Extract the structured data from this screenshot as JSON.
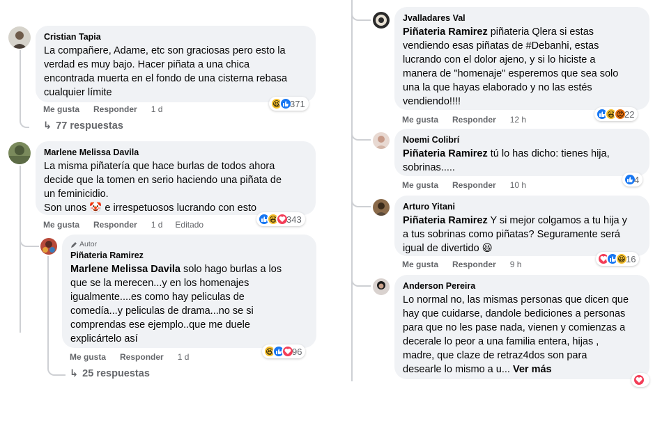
{
  "colors": {
    "bubble": "#f0f2f5",
    "meta": "#65676b",
    "like": "#1877f2",
    "haha": "#f7c12e",
    "love": "#f33e58",
    "angry": "#e9710f"
  },
  "left": {
    "c1": {
      "author": "Cristian Tapia",
      "lines": [
        "La compañere, Adame, etc son graciosas pero esto la",
        "verdad es muy bajo. Hacer piñata a una chica",
        "encontrada muerta en el fondo de una cisterna rebasa",
        "cualquier límite"
      ],
      "like": "Me gusta",
      "reply": "Responder",
      "time": "1 d",
      "reactions": [
        "haha-icon",
        "like-icon"
      ],
      "count": "371",
      "replies": "77 respuestas"
    },
    "c2": {
      "author": "Marlene Melissa Davila",
      "lines": [
        "La misma piñatería que hace burlas de todos ahora",
        "decide que la tomen en serio haciendo una piñata de",
        "un feminicidio."
      ],
      "line4_a": "Son unos",
      "line4_b": "e irrespetuosos lucrando con esto",
      "like": "Me gusta",
      "reply": "Responder",
      "time": "1 d",
      "edited": "Editado",
      "reactions": [
        "like-icon",
        "haha-icon",
        "love-icon"
      ],
      "count": "343"
    },
    "c3": {
      "badge": "Autor",
      "author": "Piñateria Ramirez",
      "mention": "Marlene Melissa Davila",
      "line1": "solo hago burlas a los",
      "lines": [
        "que se la merecen...y en los homenajes",
        "igualmente....es como hay peliculas de",
        "comedía...y peliculas de drama...no se si",
        "comprendas ese ejemplo..que me duele",
        "explicártelo así"
      ],
      "like": "Me gusta",
      "reply": "Responder",
      "time": "1 d",
      "reactions": [
        "haha-icon",
        "like-icon",
        "love-icon"
      ],
      "count": "96",
      "replies": "25 respuestas"
    }
  },
  "right": {
    "r1": {
      "author": "Jvalladares Val",
      "mention": "Piñateria Ramirez",
      "line1": "piñateria Qlera si estas",
      "lines": [
        "vendiendo esas piñatas de #Debanhi, estas",
        "lucrando con el dolor ajeno, y si lo hiciste a",
        "manera de \"homenaje\" esperemos que sea solo",
        "una la que hayas elaborado y no las estés",
        "vendiendo!!!!"
      ],
      "like": "Me gusta",
      "reply": "Responder",
      "time": "12 h",
      "reactions": [
        "like-icon",
        "haha-icon",
        "angry-icon"
      ],
      "count": "22"
    },
    "r2": {
      "author": "Noemi Colibrí",
      "mention": "Piñateria Ramirez",
      "line1": "tú lo has dicho: tienes hija,",
      "lines": [
        "sobrinas....."
      ],
      "like": "Me gusta",
      "reply": "Responder",
      "time": "10 h",
      "reactions": [
        "like-icon"
      ],
      "count": "4"
    },
    "r3": {
      "author": "Arturo Yitani",
      "mention": "Piñateria Ramirez",
      "line1": "Y si mejor colgamos a tu hija y",
      "lines": [
        "a tus sobrinas como piñatas? Seguramente será"
      ],
      "line3": "igual de divertido",
      "like": "Me gusta",
      "reply": "Responder",
      "time": "9 h",
      "reactions": [
        "love-icon",
        "like-icon",
        "haha-icon"
      ],
      "count": "16"
    },
    "r4": {
      "author": "Anderson Pereira",
      "lines": [
        "Lo normal no, las mismas personas que dicen que",
        "hay que cuidarse, dandole bediciones a personas",
        "para que no les pase nada, vienen y comienzas a",
        "decerale lo peor a una familia entera, hijas ,",
        "madre, que claze de retraz4dos son para"
      ],
      "last_line": "desearle lo mismo a u...",
      "see_more": "Ver más",
      "reactions": [
        "love-icon"
      ]
    }
  }
}
